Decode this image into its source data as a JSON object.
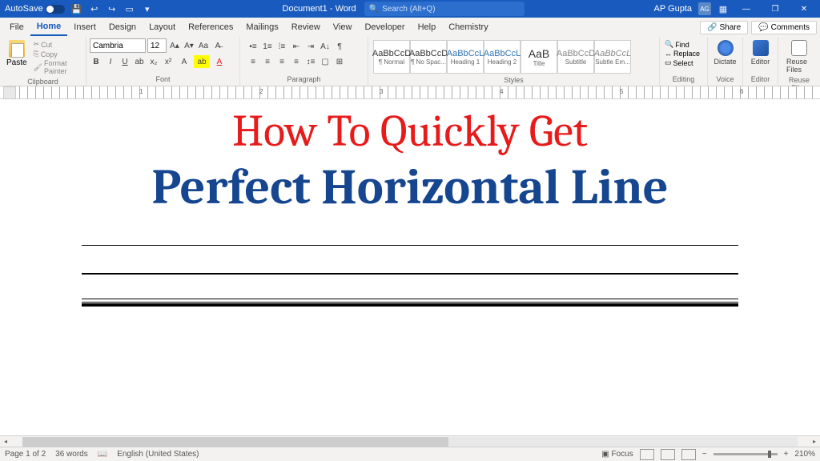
{
  "title_bar": {
    "autosave_label": "AutoSave",
    "autosave_state": "Off",
    "doc_title": "Document1 - Word",
    "search_placeholder": "Search (Alt+Q)",
    "user_name": "AP Gupta",
    "user_initials": "AG"
  },
  "menu": {
    "items": [
      "File",
      "Home",
      "Insert",
      "Design",
      "Layout",
      "References",
      "Mailings",
      "Review",
      "View",
      "Developer",
      "Help",
      "Chemistry"
    ],
    "active_index": 1,
    "share": "Share",
    "comments": "Comments"
  },
  "ribbon": {
    "clipboard": {
      "label": "Clipboard",
      "paste": "Paste",
      "cut": "Cut",
      "copy": "Copy",
      "format_painter": "Format Painter"
    },
    "font": {
      "label": "Font",
      "name": "Cambria",
      "size": "12"
    },
    "paragraph": {
      "label": "Paragraph"
    },
    "styles": {
      "label": "Styles",
      "items": [
        {
          "preview": "AaBbCcD",
          "name": "¶ Normal"
        },
        {
          "preview": "AaBbCcD",
          "name": "¶ No Spac..."
        },
        {
          "preview": "AaBbCcL",
          "name": "Heading 1"
        },
        {
          "preview": "AaBbCcL",
          "name": "Heading 2"
        },
        {
          "preview": "AaB",
          "name": "Title"
        },
        {
          "preview": "AaBbCcD",
          "name": "Subtitle"
        },
        {
          "preview": "AaBbCcL",
          "name": "Subtle Em..."
        }
      ]
    },
    "editing": {
      "label": "Editing",
      "find": "Find",
      "replace": "Replace",
      "select": "Select"
    },
    "voice": {
      "label": "Voice",
      "dictate": "Dictate"
    },
    "editor": {
      "label": "Editor",
      "button": "Editor"
    },
    "reuse": {
      "label": "Reuse Files",
      "button": "Reuse Files"
    }
  },
  "ruler_numbers": [
    "1",
    "2",
    "3",
    "4",
    "5",
    "6"
  ],
  "document": {
    "line1": "How To Quickly Get",
    "line2": "Perfect Horizontal Line"
  },
  "status": {
    "page": "Page 1 of 2",
    "words": "36 words",
    "language": "English (United States)",
    "focus": "Focus",
    "zoom": "210%"
  }
}
